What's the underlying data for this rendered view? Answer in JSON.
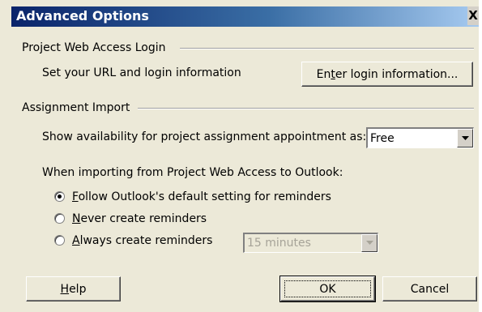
{
  "window": {
    "title": "Advanced Options",
    "close_glyph": "X"
  },
  "pwa_login": {
    "section_label": "Project Web Access Login",
    "description": "Set your URL and login information",
    "button_prefix": "En",
    "button_accel": "t",
    "button_suffix": "er login information..."
  },
  "assignment_import": {
    "section_label": "Assignment Import",
    "availability_label": "Show availability for project assignment appointment as:",
    "availability_value": "Free",
    "importing_label": "When importing from Project Web Access to Outlook:",
    "reminder_options": [
      {
        "accel": "F",
        "rest": "ollow Outlook's default setting for reminders",
        "selected": true
      },
      {
        "accel": "N",
        "rest": "ever create reminders",
        "selected": false
      },
      {
        "accel": "A",
        "rest": "lways create reminders",
        "selected": false
      }
    ],
    "reminder_interval": "15 minutes",
    "reminder_interval_enabled": false
  },
  "buttons": {
    "help_accel": "H",
    "help_rest": "elp",
    "ok": "OK",
    "cancel": "Cancel"
  },
  "colors": {
    "dialog_bg": "#ece9d8",
    "titlebar_start": "#0a246a",
    "titlebar_end": "#a6caf0"
  }
}
